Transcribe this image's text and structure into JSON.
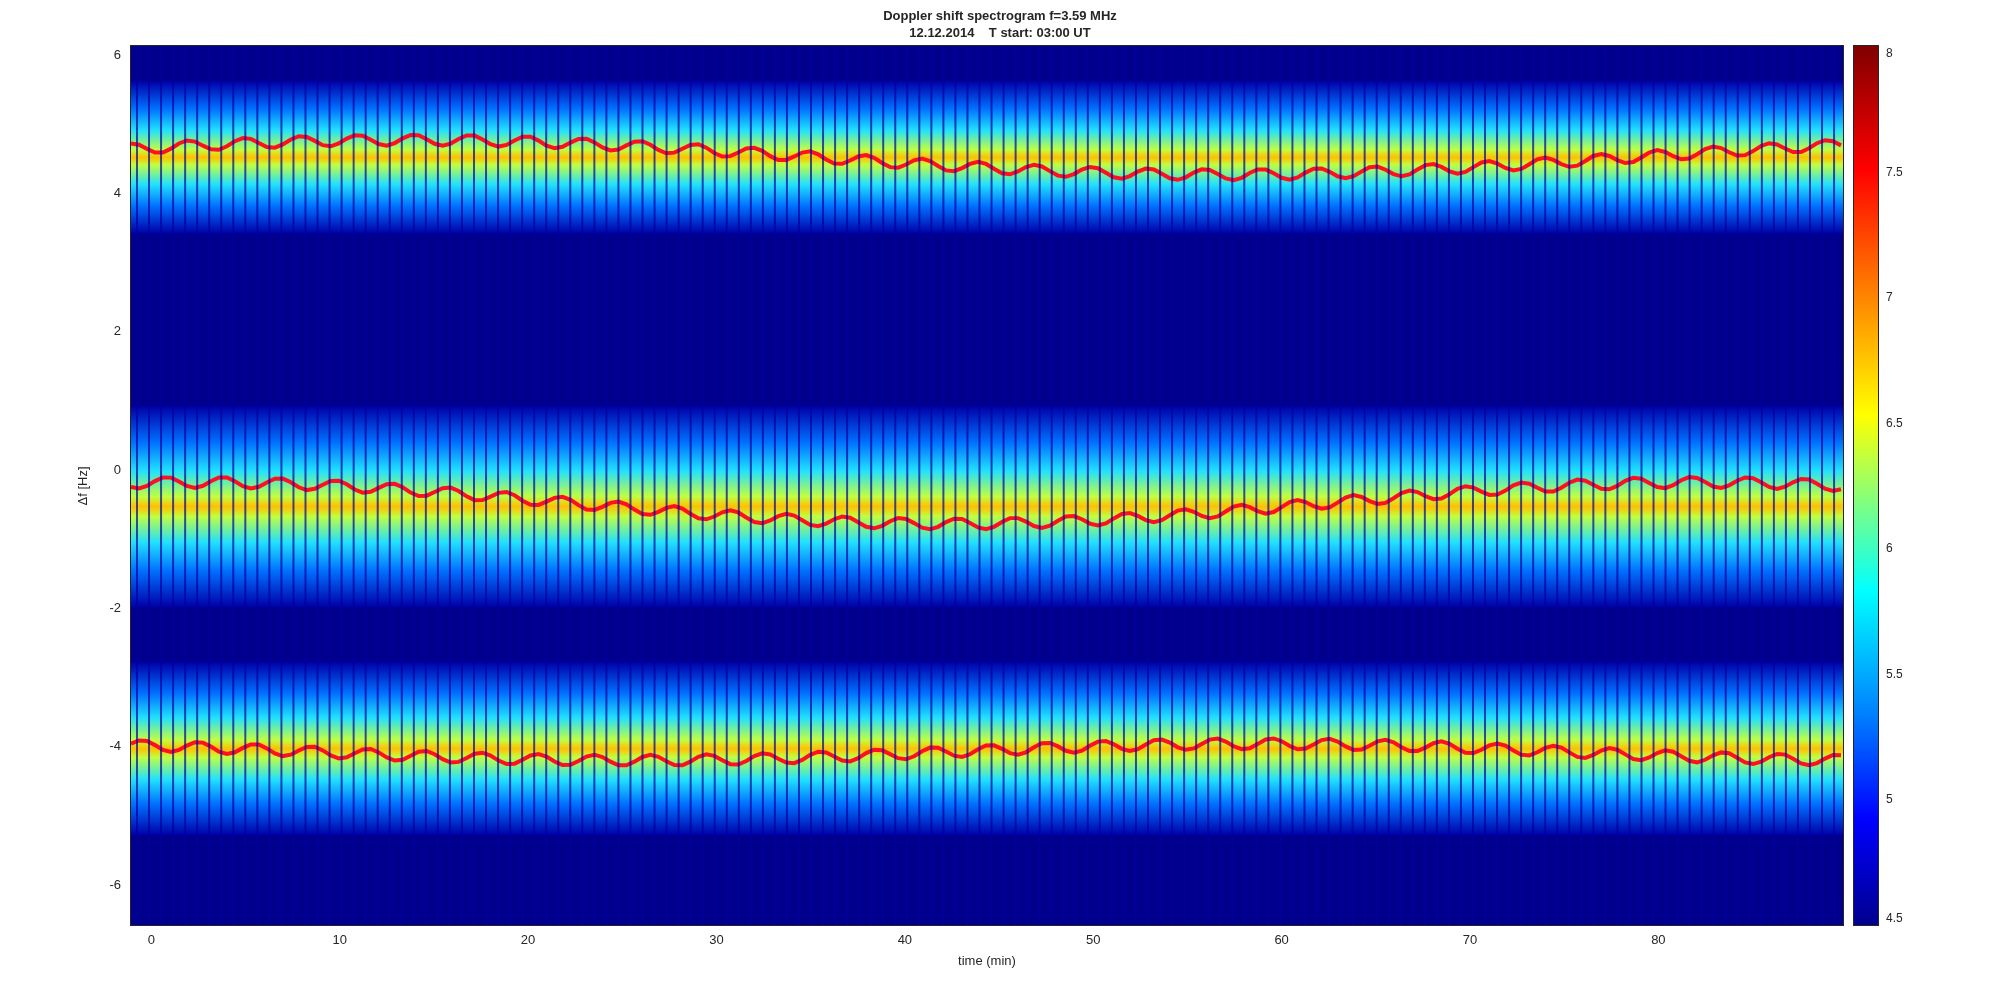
{
  "figure": {
    "title_lines": [
      "Doppler shift spectrogram f=3.59 MHz",
      "12.12.2014    T start: 03:00 UT"
    ],
    "xlabel": "time (min)",
    "ylabel": "Δf [Hz]",
    "xticks": [
      "0",
      "10",
      "20",
      "30",
      "40",
      "50",
      "60",
      "70",
      "80"
    ],
    "yticks": [
      "6",
      "4",
      "2",
      "0",
      "-2",
      "-4",
      "-6"
    ],
    "colorbar_ticks": [
      "8",
      "7.5",
      "7",
      "6.5",
      "6",
      "5.5",
      "5",
      "4.5"
    ]
  }
}
